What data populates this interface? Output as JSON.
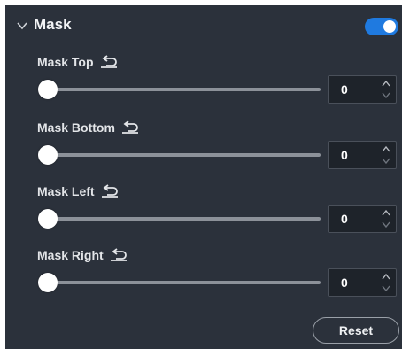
{
  "section": {
    "title": "Mask",
    "enabled": true,
    "accent_color": "#1f7ae0"
  },
  "controls": [
    {
      "label": "Mask Top",
      "value": "0",
      "slider_fraction": 0
    },
    {
      "label": "Mask Bottom",
      "value": "0",
      "slider_fraction": 0
    },
    {
      "label": "Mask Left",
      "value": "0",
      "slider_fraction": 0
    },
    {
      "label": "Mask Right",
      "value": "0",
      "slider_fraction": 0
    }
  ],
  "reset_label": "Reset",
  "icons": {
    "collapse": "chevron-down-icon",
    "reset_field": "undo-icon",
    "stepper": "stepper-arrows-icon"
  }
}
